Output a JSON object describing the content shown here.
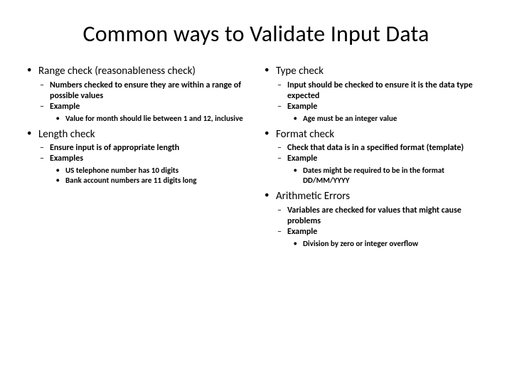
{
  "title": "Common ways to Validate Input Data",
  "left": {
    "items": [
      {
        "label": "Range check (reasonableness check)",
        "subs": [
          {
            "label": "Numbers checked to ensure they are within a range of possible values",
            "subs": []
          },
          {
            "label": "Example",
            "subs": [
              {
                "label": "Value for month should lie between 1 and 12, inclusive"
              }
            ]
          }
        ]
      },
      {
        "label": "Length check",
        "subs": [
          {
            "label": "Ensure input is of appropriate length",
            "subs": []
          },
          {
            "label": "Examples",
            "subs": [
              {
                "label": "US telephone number has 10 digits"
              },
              {
                "label": "Bank account numbers are 11 digits long"
              }
            ]
          }
        ]
      }
    ]
  },
  "right": {
    "items": [
      {
        "label": "Type check",
        "subs": [
          {
            "label": "Input should be checked to ensure it is the data type expected",
            "subs": []
          },
          {
            "label": "Example",
            "subs": [
              {
                "label": "Age must be an integer value"
              }
            ]
          }
        ]
      },
      {
        "label": "Format check",
        "subs": [
          {
            "label": "Check that data is in a specified format (template)",
            "subs": []
          },
          {
            "label": "Example",
            "subs": [
              {
                "label": "Dates might be required to be in the format DD/MM/YYYY"
              }
            ]
          }
        ]
      },
      {
        "label": "Arithmetic Errors",
        "subs": [
          {
            "label": "Variables are checked for values that might cause problems",
            "subs": []
          },
          {
            "label": "Example",
            "subs": [
              {
                "label": "Division by zero or integer overflow"
              }
            ]
          }
        ]
      }
    ]
  }
}
